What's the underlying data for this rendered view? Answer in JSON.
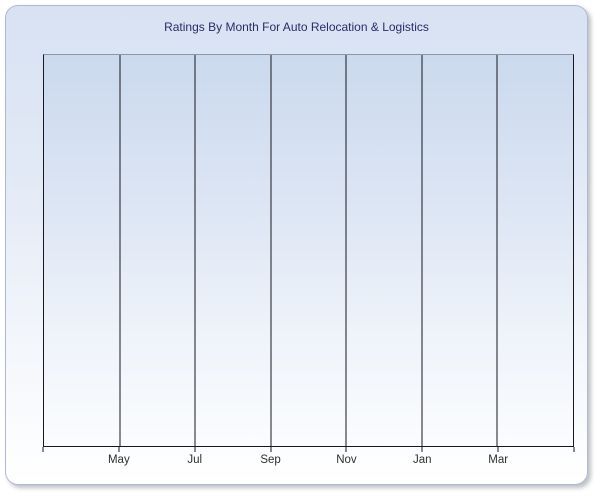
{
  "panel": {
    "title": "Ratings By Month For Auto Relocation & Logistics"
  },
  "chart_data": {
    "type": "line",
    "title": "Ratings By Month For Auto Relocation & Logistics",
    "categories": [
      "May",
      "Jul",
      "Sep",
      "Nov",
      "Jan",
      "Mar"
    ],
    "series": [],
    "xlabel": "",
    "ylabel": "",
    "y_tick_labels": [],
    "grid": "vertical-gridlines-only",
    "legend": "none",
    "plot_state": "empty - no data points or lines rendered"
  },
  "colors": {
    "panel_gradient_top": "#d8e2f3",
    "panel_gradient_bottom": "#ffffff",
    "plot_gradient_top": "#cbd9ee",
    "plot_gradient_bottom": "#fbfcfe",
    "gridline": "#17171d",
    "plot_top_border": "#8d97ab",
    "title_text": "#2b2b66",
    "axis_label_text": "#2f2f2f"
  }
}
